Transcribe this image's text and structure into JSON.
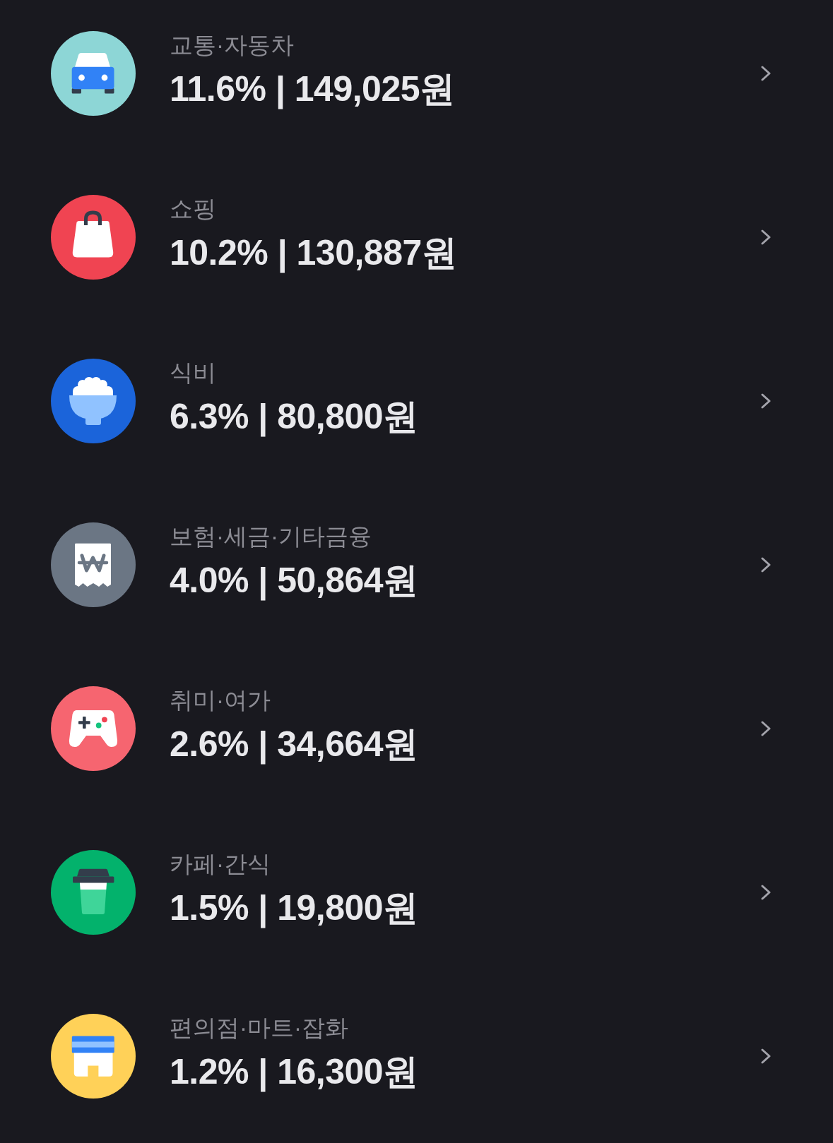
{
  "categories": [
    {
      "kind": "car",
      "name": "교통·자동차",
      "value": "11.6% | 149,025원"
    },
    {
      "kind": "bag",
      "name": "쇼핑",
      "value": "10.2% | 130,887원"
    },
    {
      "kind": "rice-bowl",
      "name": "식비",
      "value": "6.3% | 80,800원"
    },
    {
      "kind": "receipt",
      "name": "보험·세금·기타금융",
      "value": "4.0% | 50,864원"
    },
    {
      "kind": "gamepad",
      "name": "취미·여가",
      "value": "2.6% | 34,664원"
    },
    {
      "kind": "cup",
      "name": "카페·간식",
      "value": "1.5% | 19,800원"
    },
    {
      "kind": "store",
      "name": "편의점·마트·잡화",
      "value": "1.2% | 16,300원"
    }
  ]
}
